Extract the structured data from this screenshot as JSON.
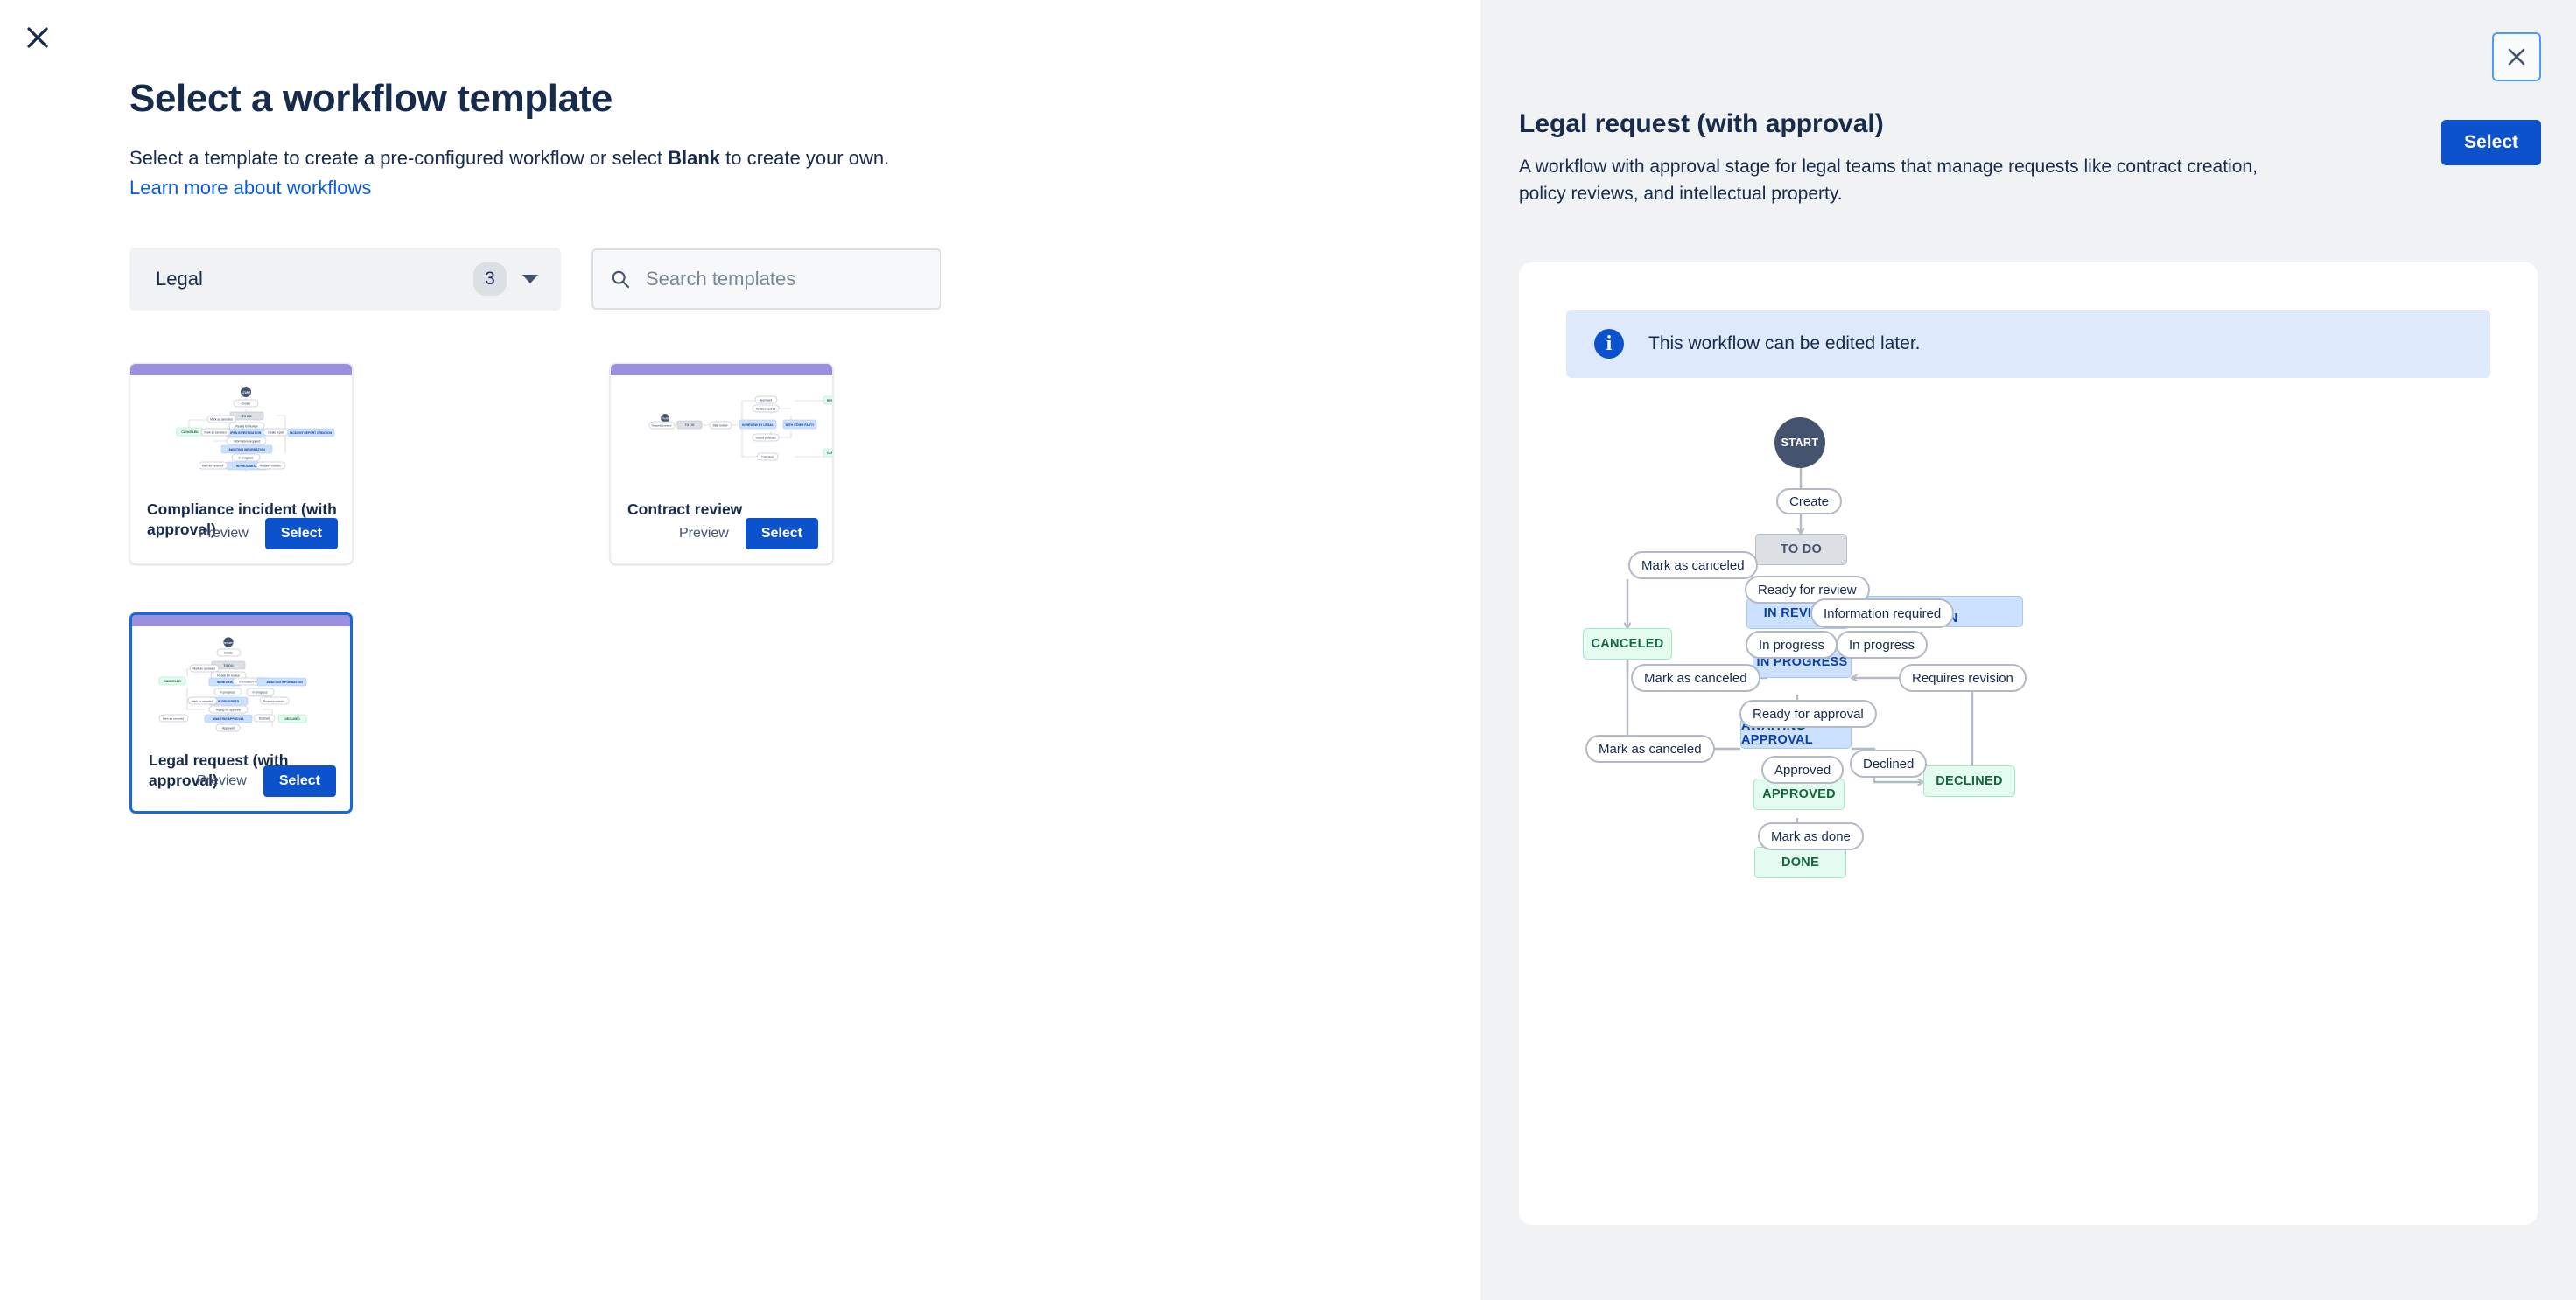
{
  "close_icon": "close-icon",
  "header": {
    "title": "Select a workflow template",
    "subtitle_before": "Select a template to create a pre-configured workflow or select ",
    "subtitle_bold": "Blank",
    "subtitle_after": " to create your own.",
    "learn_more": "Learn more about workflows"
  },
  "filters": {
    "category_label": "Legal",
    "category_count": "3",
    "chevron_icon": "chevron-down-icon",
    "search_placeholder": "Search templates",
    "search_value": "",
    "search_icon": "search-icon"
  },
  "actions": {
    "preview": "Preview",
    "select": "Select"
  },
  "templates": [
    {
      "title": "Compliance incident (with approval)",
      "preview_label": "Preview",
      "select_label": "Select",
      "selected": false,
      "accent": "#9A90DE"
    },
    {
      "title": "Contract review",
      "preview_label": "Preview",
      "select_label": "Select",
      "selected": false,
      "accent": "#9A90DE"
    },
    {
      "title": "Legal request (with approval)",
      "preview_label": "Preview",
      "select_label": "Select",
      "selected": true,
      "accent": "#9A90DE"
    }
  ],
  "detail": {
    "close_icon": "close-icon",
    "title": "Legal request (with approval)",
    "description": "A workflow with approval stage for legal teams that manage requests like contract creation, policy reviews, and intellectual property.",
    "select_label": "Select",
    "info_icon": "info-icon",
    "info_text": "This workflow can be edited later.",
    "workflow": {
      "statuses": [
        {
          "name": "START",
          "kind": "start"
        },
        {
          "name": "TO DO",
          "kind": "todo"
        },
        {
          "name": "CANCELED",
          "kind": "green"
        },
        {
          "name": "IN REVIEW",
          "kind": "blue"
        },
        {
          "name": "AWAITING INFORMATION",
          "kind": "blue"
        },
        {
          "name": "IN PROGRESS",
          "kind": "blue"
        },
        {
          "name": "AWAITING APPROVAL",
          "kind": "blue"
        },
        {
          "name": "DECLINED",
          "kind": "green"
        },
        {
          "name": "APPROVED",
          "kind": "green"
        },
        {
          "name": "DONE",
          "kind": "green"
        }
      ],
      "transitions": [
        "Create",
        "Mark as canceled",
        "Ready for review",
        "Information required",
        "In progress",
        "In progress",
        "Mark as canceled",
        "Requires revision",
        "Ready for approval",
        "Mark as canceled",
        "Declined",
        "Approved",
        "Mark as done"
      ]
    }
  },
  "colors": {
    "accent_blue": "#0C52CC",
    "link_blue": "#0B5CD5",
    "selected_border": "#1868DB",
    "card_accent": "#9A90DE",
    "status_blue_bg": "#CCE0FF",
    "status_green_bg": "#E3FCEF",
    "status_todo_bg": "#DCDFE4",
    "start_node": "#44546F",
    "info_bg": "#DEE9FC",
    "panel_bg": "#F1F2F4"
  }
}
